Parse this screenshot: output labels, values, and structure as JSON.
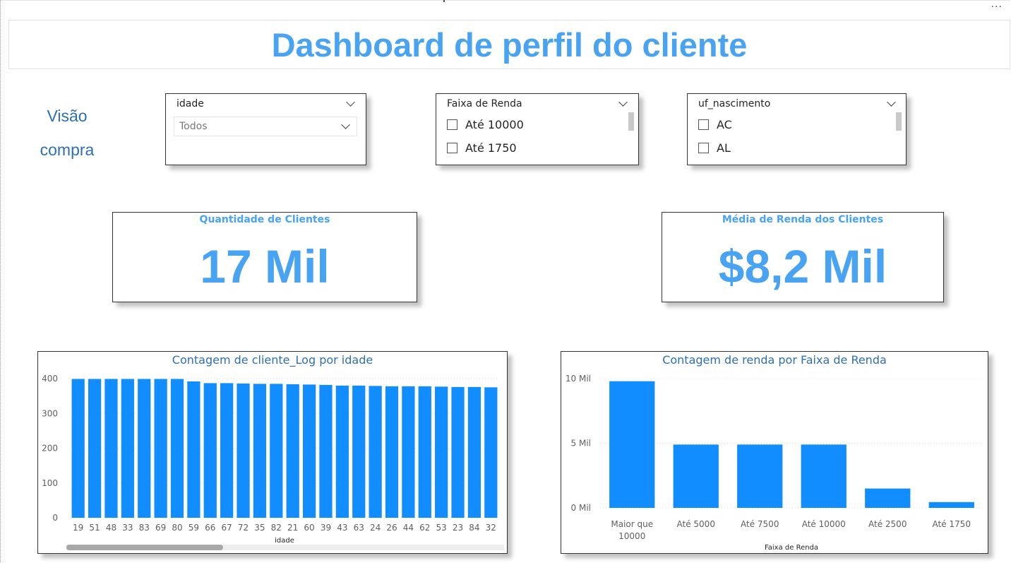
{
  "header": {
    "title": "Dashboard de perfil do cliente",
    "more_label": "···"
  },
  "side_label": {
    "line1": "Visão",
    "line2": "compra"
  },
  "slicers": {
    "idade": {
      "title": "idade",
      "selected": "Todos"
    },
    "faixa": {
      "title": "Faixa de Renda",
      "options": [
        "Até 10000",
        "Até 1750"
      ]
    },
    "uf": {
      "title": "uf_nascimento",
      "options": [
        "AC",
        "AL"
      ]
    }
  },
  "cards": {
    "clientes": {
      "title": "Quantidade de Clientes",
      "value": "17 Mil"
    },
    "renda": {
      "title": "Média de Renda dos Clientes",
      "value": "$8,2 Mil"
    }
  },
  "colors": {
    "accent": "#48a3f3",
    "bar": "#118dff",
    "title_blue": "#2e6fb0"
  },
  "icons": {
    "dropdown": "chevron-down-icon",
    "checkbox": "checkbox-icon"
  },
  "chart_data": [
    {
      "type": "bar",
      "title": "Contagem de cliente_Log por idade",
      "xlabel": "idade",
      "ylabel": "",
      "categories": [
        "19",
        "51",
        "48",
        "33",
        "83",
        "69",
        "80",
        "59",
        "66",
        "67",
        "72",
        "35",
        "82",
        "21",
        "60",
        "39",
        "43",
        "63",
        "24",
        "26",
        "44",
        "62",
        "53",
        "23",
        "84",
        "32"
      ],
      "values": [
        399,
        399,
        399,
        399,
        399,
        399,
        399,
        392,
        387,
        387,
        386,
        385,
        385,
        384,
        383,
        382,
        380,
        380,
        379,
        378,
        378,
        378,
        377,
        376,
        376,
        375
      ],
      "ylim": [
        0,
        400
      ],
      "yticks": [
        "0",
        "100",
        "200",
        "300",
        "400"
      ],
      "grid": true
    },
    {
      "type": "bar",
      "title": "Contagem de renda por Faixa de Renda",
      "xlabel": "Faixa de Renda",
      "ylabel": "",
      "categories": [
        [
          "Maior que",
          "10000"
        ],
        [
          "Até 5000"
        ],
        [
          "Até 7500"
        ],
        [
          "Até 10000"
        ],
        [
          "Até 2500"
        ],
        [
          "Até 1750"
        ]
      ],
      "values": [
        9800,
        4900,
        4900,
        4900,
        1500,
        450
      ],
      "ylim": [
        0,
        10000
      ],
      "yticks": [
        "0 Mil",
        "5 Mil",
        "10 Mil"
      ],
      "grid": true
    }
  ]
}
